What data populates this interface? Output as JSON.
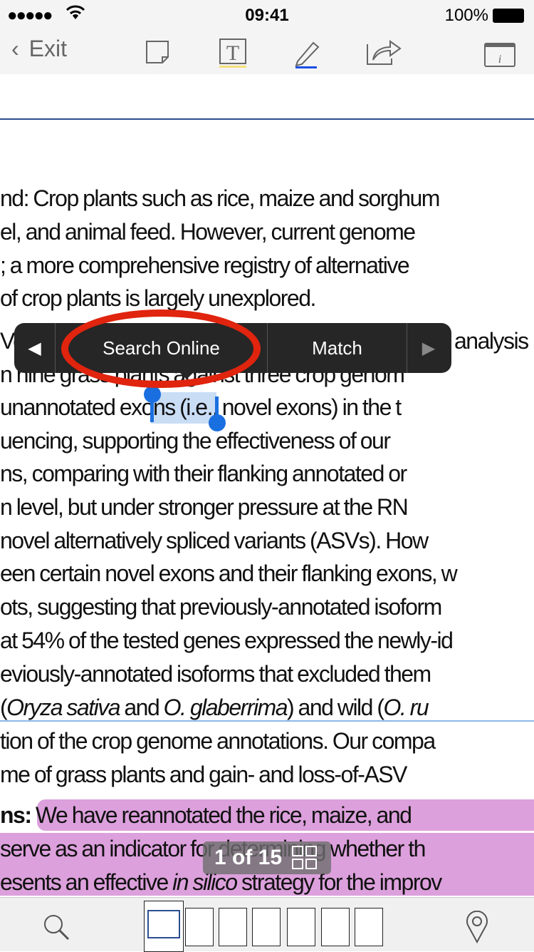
{
  "status": {
    "signal": "●●●●●",
    "time": "09:41",
    "battery": "100%"
  },
  "toolbar": {
    "exit": "Exit",
    "info": "i"
  },
  "document": {
    "lines": [
      "nd: Crop plants such as rice, maize and  sorghum",
      "el, and animal feed. However, current genome",
      "; a more comprehensive registry of alternative",
      "of crop plants is largely unexplored.",
      "Ve",
      "analysis",
      "n nine grass plants against three crop genom",
      "unannotated ",
      "exons",
      " (i.e., novel exons) in the t",
      "uencing, supporting the effectiveness of our",
      "ns, comparing with their flanking annotated or",
      "n level, but under stronger pressure at the RN",
      "novel alternatively spliced variants (ASVs). How",
      "een certain novel exons and their flanking exons, w",
      "ots, suggesting that previously-annotated isoform",
      "at 54% of the tested genes expressed the newly-id",
      "eviously-annotated isoforms that excluded them",
      "(",
      "Oryza sativa",
      " and ",
      "O. glaberrima",
      ") and wild (",
      "O. ru",
      "tion of the crop genome annotations. Our compa",
      "me of grass plants and gain- and loss-of-ASV",
      "ns:",
      " We have reannotated the rice, maize, and",
      " serve as an indicator for determining whether th",
      "esents an effective ",
      "in silico",
      " strategy for the improv"
    ]
  },
  "context_menu": {
    "items": [
      "Search Online",
      "Match"
    ]
  },
  "page_indicator": "1 of 15",
  "colors": {
    "highlight": "#dca0dc",
    "selection": "#c9ddf5",
    "annotation_oval": "#e0240e",
    "handle": "#1a6fe0"
  }
}
